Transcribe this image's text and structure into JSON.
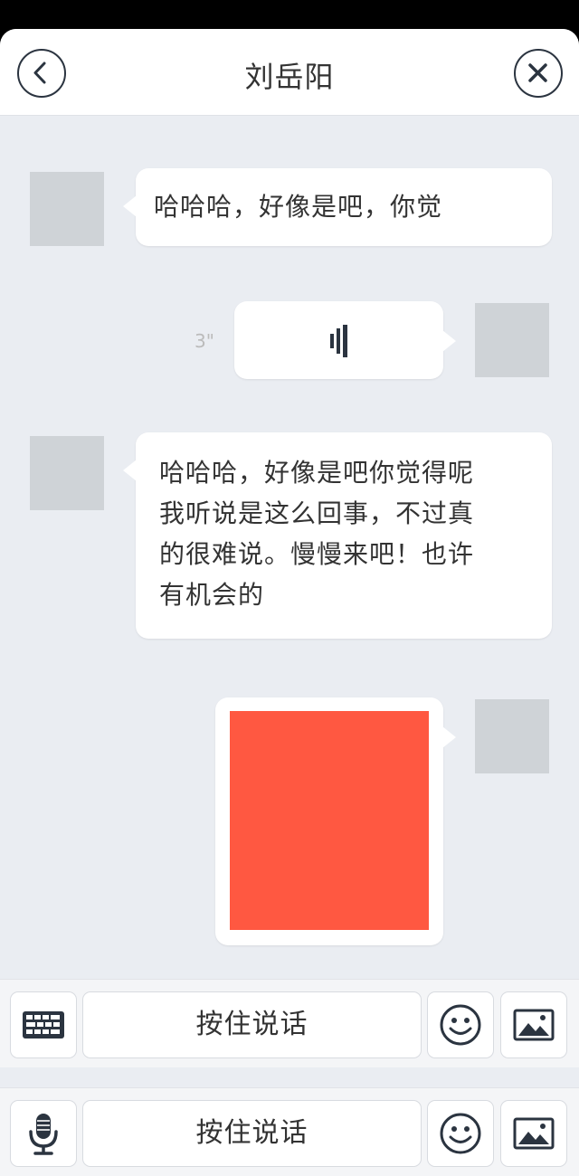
{
  "header": {
    "title": "刘岳阳",
    "back_icon": "chevron-left-icon",
    "close_icon": "close-icon"
  },
  "messages": [
    {
      "side": "left",
      "type": "text",
      "text": "哈哈哈，好像是吧，你觉"
    },
    {
      "side": "right",
      "type": "voice",
      "duration": "3\"",
      "icon": "voice-bars-icon"
    },
    {
      "side": "left",
      "type": "text",
      "lines": [
        "哈哈哈，好像是吧你觉得呢",
        "我听说是这么回事，不过真",
        "的很难说。慢慢来吧！也许",
        "有机会的"
      ]
    },
    {
      "side": "right",
      "type": "image",
      "image_color": "#ff5841"
    }
  ],
  "toolbars": [
    {
      "mode_icon": "keyboard-icon",
      "talk_label": "按住说话",
      "emoji_icon": "smiley-icon",
      "image_icon": "image-icon"
    },
    {
      "mode_icon": "microphone-icon",
      "talk_label": "按住说话",
      "emoji_icon": "smiley-icon",
      "image_icon": "image-icon"
    }
  ],
  "colors": {
    "chat_background": "#eaedf2",
    "bubble": "#ffffff",
    "avatar_placeholder": "#cfd3d7",
    "icon_dark": "#2b3440"
  }
}
